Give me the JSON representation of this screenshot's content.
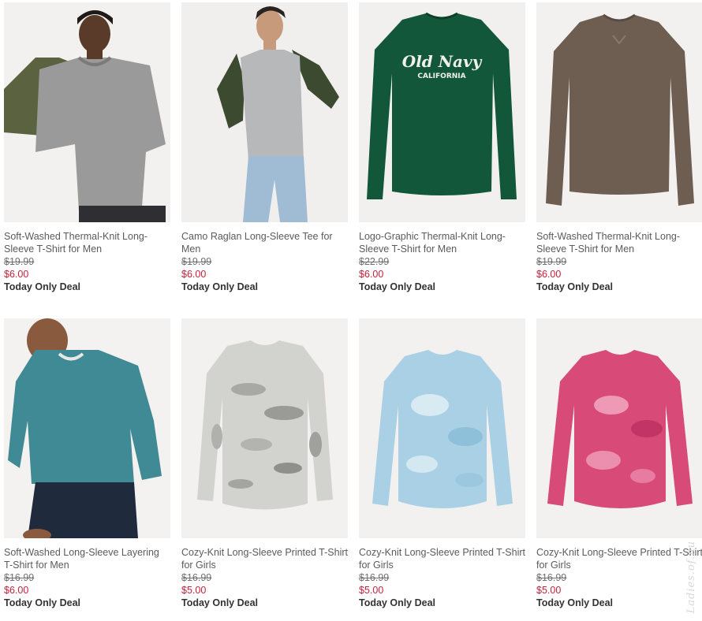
{
  "products": [
    {
      "title": "Soft-Washed Thermal-Knit Long-Sleeve T-Shirt for Men",
      "old_price": "$19.99",
      "sale_price": "$6.00",
      "deal": "Today Only Deal",
      "image": "man-gray-thermal-shirt"
    },
    {
      "title": "Camo Raglan Long-Sleeve Tee for Men",
      "old_price": "$19.99",
      "sale_price": "$6.00",
      "deal": "Today Only Deal",
      "image": "man-raglan-tee"
    },
    {
      "title": "Logo-Graphic Thermal-Knit Long-Sleeve T-Shirt for Men",
      "old_price": "$22.99",
      "sale_price": "$6.00",
      "deal": "Today Only Deal",
      "image": "green-logo-shirt",
      "graphic_text": "Old Navy",
      "graphic_subtext": "CALIFORNIA"
    },
    {
      "title": "Soft-Washed Thermal-Knit Long-Sleeve T-Shirt for Men",
      "old_price": "$19.99",
      "sale_price": "$6.00",
      "deal": "Today Only Deal",
      "image": "brown-thermal-shirt"
    },
    {
      "title": "Soft-Washed Long-Sleeve Layering T-Shirt for Men",
      "old_price": "$16.99",
      "sale_price": "$6.00",
      "deal": "Today Only Deal",
      "image": "man-teal-shirt"
    },
    {
      "title": "Cozy-Knit Long-Sleeve Printed T-Shirt for Girls",
      "old_price": "$16.99",
      "sale_price": "$5.00",
      "deal": "Today Only Deal",
      "image": "gray-camo-shirt"
    },
    {
      "title": "Cozy-Knit Long-Sleeve Printed T-Shirt for Girls",
      "old_price": "$16.99",
      "sale_price": "$5.00",
      "deal": "Today Only Deal",
      "image": "blue-tie-dye-shirt"
    },
    {
      "title": "Cozy-Knit Long-Sleeve Printed T-Shirt for Girls",
      "old_price": "$16.99",
      "sale_price": "$5.00",
      "deal": "Today Only Deal",
      "image": "pink-tie-dye-shirt"
    }
  ],
  "watermark": "Ladies.of.nu",
  "colors": {
    "sale": "#c8203a",
    "title": "#5b5b5b",
    "deal": "#333333"
  }
}
